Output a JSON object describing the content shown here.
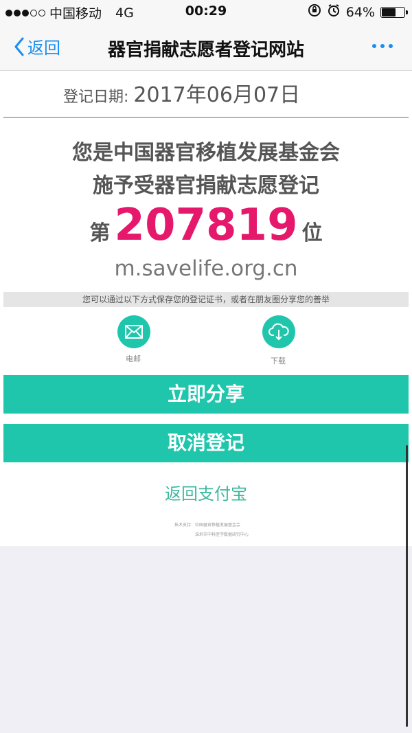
{
  "status": {
    "carrier": "中国移动",
    "network": "4G",
    "time": "00:29",
    "battery": "64%",
    "battery_level": 0.64
  },
  "nav": {
    "back_label": "返回",
    "title": "器官捐献志愿者登记网站"
  },
  "registration": {
    "date_label": "登记日期:",
    "date_value": "2017年06月07日"
  },
  "headline": {
    "line1": "您是中国器官移植发展基金会",
    "line2": "施予受器官捐献志愿登记",
    "number_prefix": "第",
    "number": "207819",
    "number_suffix": "位",
    "site": "m.savelife.org.cn"
  },
  "save_hint": "您可以通过以下方式保存您的登记证书，或者在朋友圈分享您的善举",
  "options": {
    "email_label": "电邮",
    "download_label": "下载"
  },
  "buttons": {
    "share": "立即分享",
    "cancel": "取消登记",
    "back_alipay": "返回支付宝"
  },
  "tech_support": {
    "label": "技术支持：",
    "org1": "中国器官移植发展基金会",
    "org2": "深圳市中科医学数据研究中心"
  },
  "colors": {
    "accent": "#20c6ac",
    "number": "#e6186c",
    "nav_link": "#1a8ef0"
  }
}
